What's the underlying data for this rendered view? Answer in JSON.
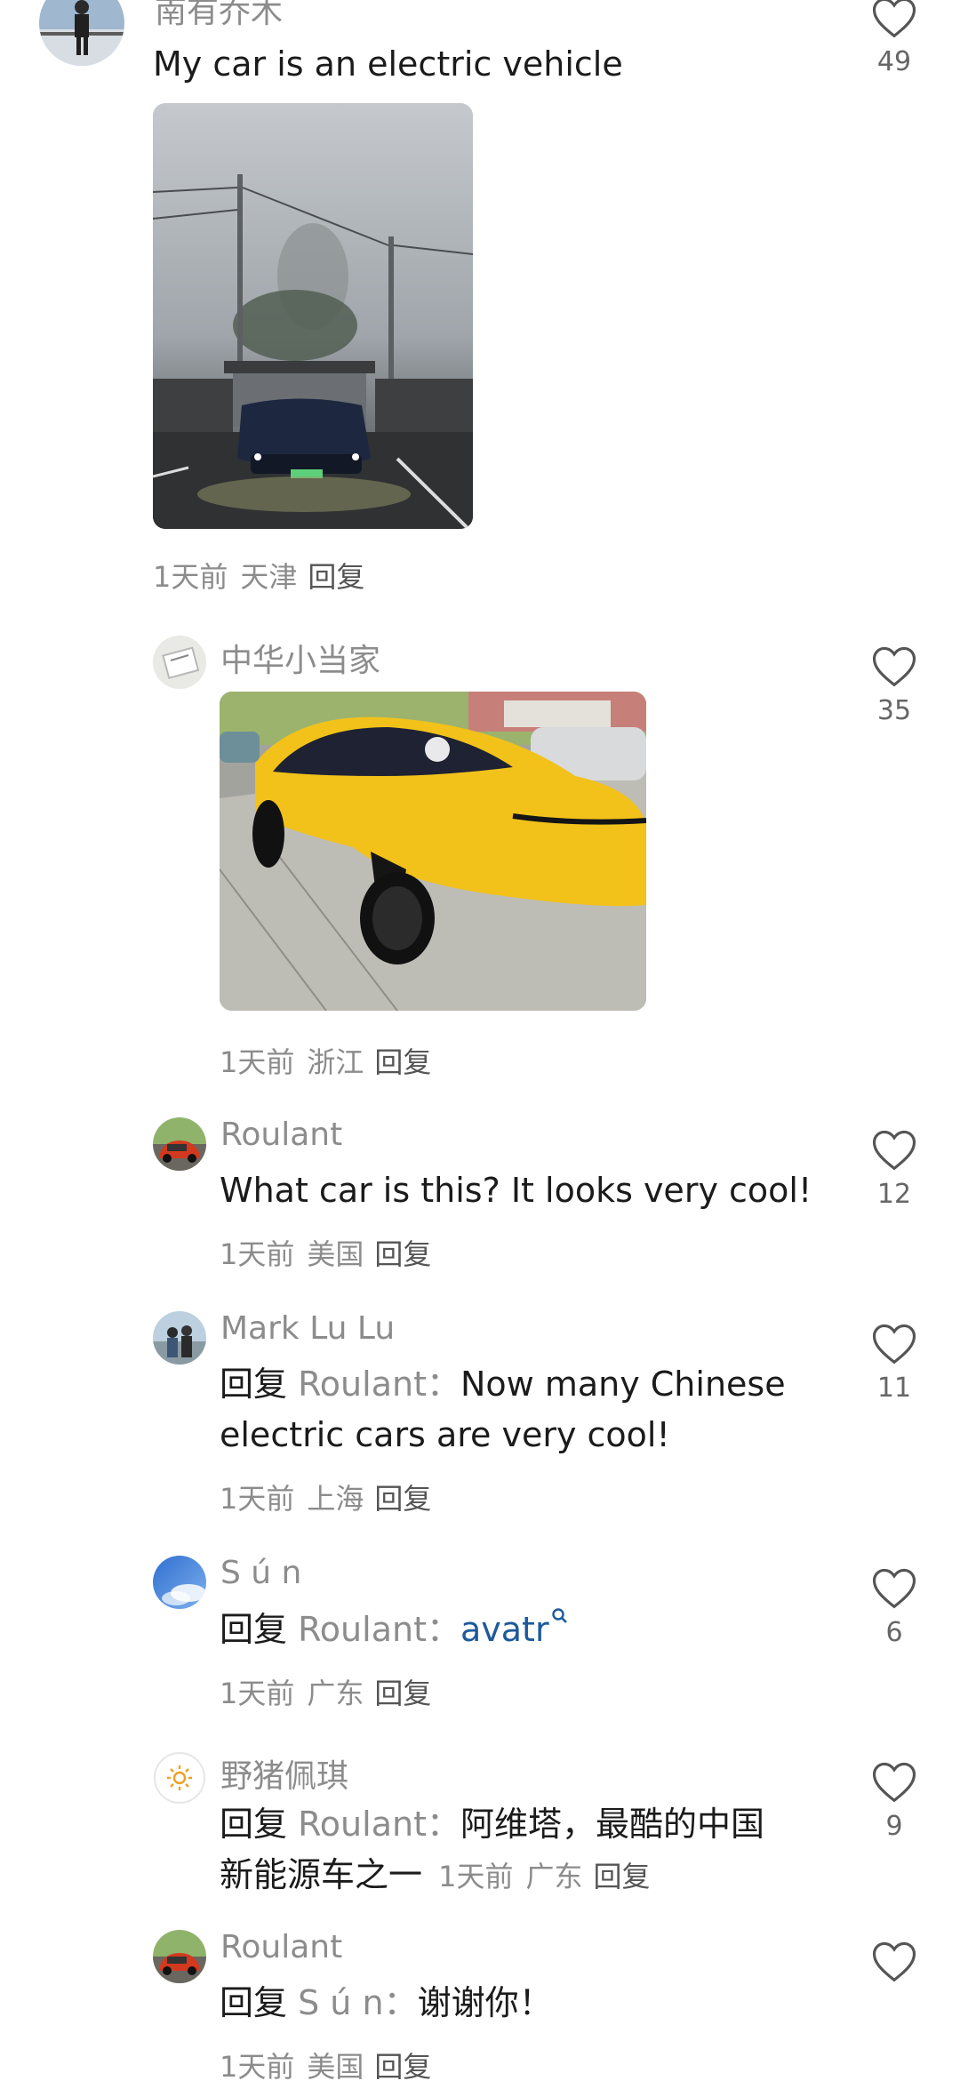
{
  "comments": [
    {
      "name": "南有乔木",
      "text": "My car is an electric vehicle",
      "meta": {
        "time": "1天前",
        "location": "天津",
        "reply": "回复"
      },
      "likes": "49"
    },
    {
      "name": "中华小当家",
      "meta": {
        "time": "1天前",
        "location": "浙江",
        "reply": "回复"
      },
      "likes": "35"
    },
    {
      "name": "Roulant",
      "text": "What car is this? It looks very cool!",
      "meta": {
        "time": "1天前",
        "location": "美国",
        "reply": "回复"
      },
      "likes": "12"
    },
    {
      "name": "Mark Lu Lu",
      "reply_word": "回复",
      "reply_target": "Roulant",
      "colon": "：",
      "text_line1": "Now many Chinese",
      "text_line2": "electric cars are very cool!",
      "meta": {
        "time": "1天前",
        "location": "上海",
        "reply": "回复"
      },
      "likes": "11"
    },
    {
      "name": "S ú n",
      "reply_word": "回复",
      "reply_target": "Roulant",
      "colon": "：",
      "link_text": "avatr",
      "meta": {
        "time": "1天前",
        "location": "广东",
        "reply": "回复"
      },
      "likes": "6"
    },
    {
      "name": "野猪佩琪",
      "reply_word": "回复",
      "reply_target": "Roulant",
      "colon": "：",
      "text_line1": "阿维塔，最酷的中国",
      "text_line2": "新能源车之一",
      "meta": {
        "time": "1天前",
        "location": "广东",
        "reply": "回复"
      },
      "likes": "9"
    },
    {
      "name": "Roulant",
      "reply_word": "回复",
      "reply_target": "S ú n",
      "colon": "：",
      "text": "谢谢你！",
      "meta": {
        "time": "1天前",
        "location": "美国",
        "reply": "回复"
      },
      "likes": ""
    }
  ],
  "colors": {
    "link": "#1d5a9a",
    "muted": "#8c8c8c"
  },
  "icons": {
    "like": "heart-outline-icon",
    "search_link": "search-icon"
  }
}
